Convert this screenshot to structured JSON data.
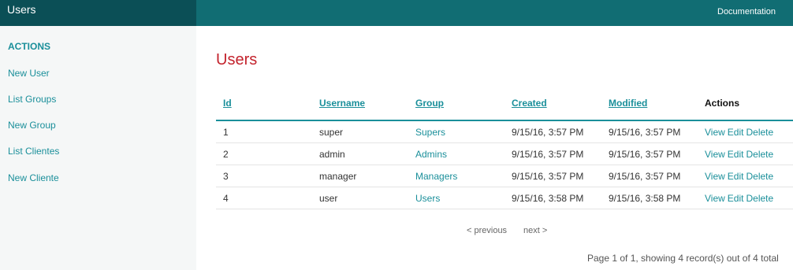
{
  "topbar": {
    "title": "Users",
    "doc_link": "Documentation"
  },
  "sidebar": {
    "heading": "ACTIONS",
    "items": [
      "New User",
      "List Groups",
      "New Group",
      "List Clientes",
      "New Cliente"
    ]
  },
  "main": {
    "title": "Users",
    "columns": [
      "Id",
      "Username",
      "Group",
      "Created",
      "Modified",
      "Actions"
    ],
    "rows": [
      {
        "id": "1",
        "username": "super",
        "group": "Supers",
        "created": "9/15/16, 3:57 PM",
        "modified": "9/15/16, 3:57 PM"
      },
      {
        "id": "2",
        "username": "admin",
        "group": "Admins",
        "created": "9/15/16, 3:57 PM",
        "modified": "9/15/16, 3:57 PM"
      },
      {
        "id": "3",
        "username": "manager",
        "group": "Managers",
        "created": "9/15/16, 3:57 PM",
        "modified": "9/15/16, 3:57 PM"
      },
      {
        "id": "4",
        "username": "user",
        "group": "Users",
        "created": "9/15/16, 3:58 PM",
        "modified": "9/15/16, 3:58 PM"
      }
    ],
    "actions": {
      "view": "View",
      "edit": "Edit",
      "delete": "Delete"
    },
    "pager": {
      "prev": "< previous",
      "next": "next >"
    },
    "summary": "Page 1 of 1, showing 4 record(s) out of 4 total"
  }
}
